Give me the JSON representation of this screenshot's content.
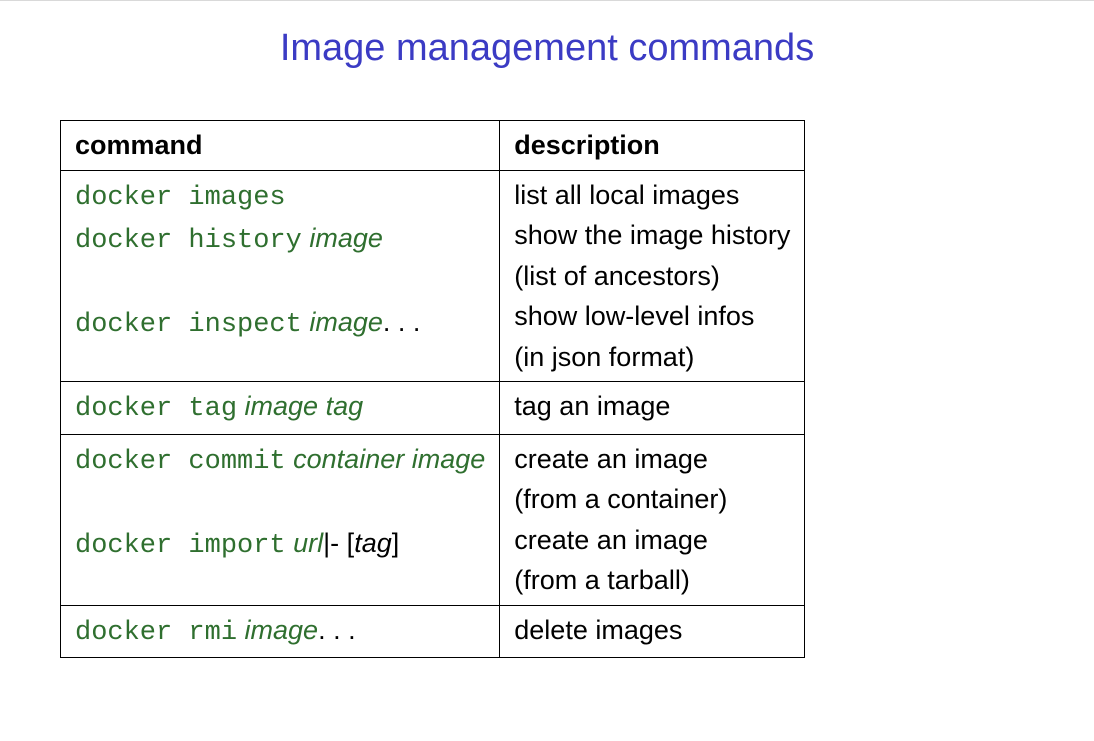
{
  "title": "Image management commands",
  "headers": {
    "c1": "command",
    "c2": "description"
  },
  "g1": {
    "r1": {
      "cmd": "docker images",
      "desc": "list all local images"
    },
    "r2": {
      "cmd": "docker history",
      "arg": " image",
      "desc": "show the image history\n(list of ancestors)"
    },
    "r3": {
      "cmd": "docker inspect",
      "arg": " image",
      "trail": ". . .",
      "desc": "show low-level infos\n(in json format)"
    }
  },
  "g2": {
    "r1": {
      "cmd": "docker tag",
      "arg": " image tag",
      "desc": "tag an image"
    }
  },
  "g3": {
    "r1": {
      "cmd": "docker commit",
      "arg": " container image",
      "desc": "create an image\n(from a container)"
    },
    "r2": {
      "cmd": "docker import",
      "arg": " url",
      "extra1": "|-",
      "extra2": " [",
      "extra3": "tag",
      "extra4": "]",
      "desc": "create an image\n(from a tarball)"
    }
  },
  "g4": {
    "r1": {
      "cmd": "docker rmi",
      "arg": " image",
      "trail": ". . .",
      "desc": "delete images"
    }
  }
}
